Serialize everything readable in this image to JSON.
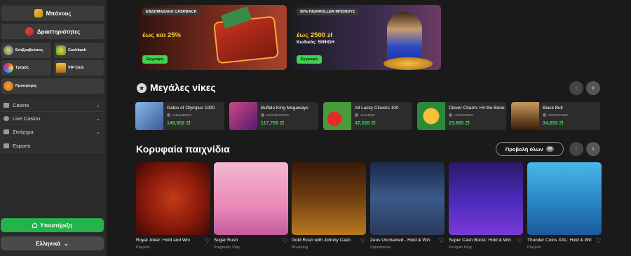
{
  "sidebar": {
    "bonuses": "Μπόνους",
    "activities": "Δραστηριότητες",
    "tiles": [
      {
        "label": "Επιβραβεύσεις",
        "icon": "rewards-icon"
      },
      {
        "label": "Cashback",
        "icon": "cashback-icon"
      },
      {
        "label": "Τροχός",
        "icon": "wheel-icon"
      },
      {
        "label": "VIP Club",
        "icon": "vip-crown-icon"
      },
      {
        "label": "Προσφορές",
        "icon": "offers-icon"
      }
    ],
    "accordion": [
      {
        "label": "Casino",
        "icon": "casino-icon"
      },
      {
        "label": "Live Casino",
        "icon": "live-casino-icon"
      },
      {
        "label": "Στοίχημα",
        "icon": "betting-icon"
      },
      {
        "label": "Esports",
        "icon": "esports-icon"
      }
    ],
    "support": "Υποστήριξη",
    "language": "Ελληνικά"
  },
  "banners": [
    {
      "tag": "ΕΒΔΟΜΑΔΙΑΙΟ CASHBACK",
      "title": "έως και 25%",
      "sub": "",
      "button": "Εγγραφή"
    },
    {
      "tag": "50% HIGHROLLER ΜΠΟΝΟΥΣ",
      "title": "έως 2500 zł",
      "sub": "Κωδικός: 50HIGH",
      "button": "Εγγραφή"
    }
  ],
  "big_wins": {
    "title": "Μεγάλες νίκες",
    "items": [
      {
        "game": "Gates of Olympus 1000",
        "user": "Urban563241",
        "amount": "149,682 Zł",
        "color": "#4a6fa5"
      },
      {
        "game": "Buffalo King Megaways",
        "user": "Kenneth122373",
        "amount": "117,789 Zł",
        "color": "#7a3a8a"
      },
      {
        "game": "All Lucky Clovers 100",
        "user": "Amarti225",
        "amount": "47,528 Zł",
        "color": "#3a8a2a"
      },
      {
        "game": "Clover Charm: Hit the Bonus",
        "user": "Urban563241",
        "amount": "23,860 Zł",
        "color": "#2a7a3a"
      },
      {
        "game": "Black Bull",
        "user": "Plant6724383",
        "amount": "34,853 Zł",
        "color": "#5a3a1a"
      }
    ]
  },
  "top_games": {
    "title": "Κορυφαία παιχνίδια",
    "view_all": "Προβολή όλων",
    "count": "50",
    "items": [
      {
        "name": "Royal Joker: Hold and Win",
        "provider": "Playson",
        "bg": "radial-gradient(circle at 50% 50%, #c23a1a 0%, #8a1a0a 55%, #3a0a05 100%)"
      },
      {
        "name": "Sugar Rush",
        "provider": "Pragmatic Play",
        "bg": "linear-gradient(180deg, #f4b7d2 0%, #e88ab8 60%, #c45a9a 100%)"
      },
      {
        "name": "Gold Rush with Johnny Cash",
        "provider": "BGaming",
        "bg": "linear-gradient(180deg, #3a1a0a 0%, #6a3a10 45%, #b87a20 100%)"
      },
      {
        "name": "Zeus Unchained - Hold & Win",
        "provider": "Spinomenal",
        "bg": "linear-gradient(180deg, #1a2a4a 0%, #3a5a8a 50%, #2a3a5a 100%)"
      },
      {
        "name": "Super Cash Boost: Hold & Win",
        "provider": "Penguin King",
        "bg": "linear-gradient(180deg, #2a1a6a 0%, #4a2ab8 50%, #7a3ad8 100%)"
      },
      {
        "name": "Thunder Coins XXL: Hold & Win",
        "provider": "Playson",
        "bg": "linear-gradient(180deg, #4ab8e8 0%, #2a8ac8 50%, #1a5a9a 100%)"
      }
    ]
  }
}
